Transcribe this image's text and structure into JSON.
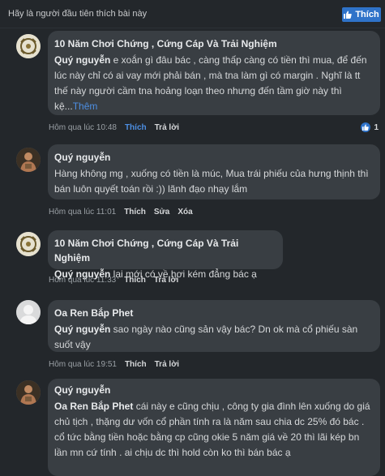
{
  "header": {
    "first_to_like": "Hãy là người đầu tiên thích bài này",
    "like_button": "Thích"
  },
  "comments": [
    {
      "author": "10 Năm Chơi Chứng , Cứng Cáp Và Trải Nghiệm",
      "mention": "Quý nguyễn",
      "text": " e xoắn gì đâu bác , càng thấp càng có tiền thì mua, để đến lúc này chỉ có ai vay mới phải bán , mà tna làm gì có margin . Nghĩ là tt thế này người cầm tna hoảng loạn theo nhưng đến tầm giờ này thì kệ...",
      "more": "Thêm",
      "time": "Hôm qua lúc 10:48",
      "actions": [
        "Thích",
        "Trả lời"
      ],
      "reaction_count": "1"
    },
    {
      "author": "Quý nguyễn",
      "mention": "",
      "text": "Hàng không mg , xuống có tiền là múc, Mua trái phiếu của hưng thịnh thì bán luôn quyết toán rồi :)) lãnh đạo nhạy lắm",
      "time": "Hôm qua lúc 11:01",
      "actions": [
        "Thích",
        "Sửa",
        "Xóa"
      ]
    },
    {
      "author": "10 Năm Chơi Chứng , Cứng Cáp Và Trải Nghiệm",
      "mention": "Quý nguyễn",
      "text": " lại mới có về hơi kém đẳng bác ạ",
      "time": "Hôm qua lúc 11:33",
      "actions": [
        "Thích",
        "Trả lời"
      ]
    },
    {
      "author": "Oa Ren Bắp Phet",
      "mention": "Quý nguyễn",
      "text": " sao ngày nào cũng sản vậy bác? Dn ok mà cổ phiếu sàn suốt vậy",
      "time": "Hôm qua lúc 19:51",
      "actions": [
        "Thích",
        "Trả lời"
      ]
    },
    {
      "author": "Quý nguyễn",
      "mention": "Oa Ren Bắp Phet",
      "text": " cái này e cũng chịu , công ty gia đình lên xuống do giá chủ tịch , thặng dư vốn cổ phần tính ra là năm sau chia dc 25% đó bác . cổ tức bằng tiền hoặc bằng cp cũng okie 5 năm giá về 20 thì lãi kép bn lần mn cứ tính . ai chịu dc thì hold còn ko thì bán bác ạ"
    }
  ],
  "colors": {
    "background": "#23272b",
    "bubble": "#393e43",
    "accent": "#2f73c9",
    "link": "#4d8fe3"
  }
}
